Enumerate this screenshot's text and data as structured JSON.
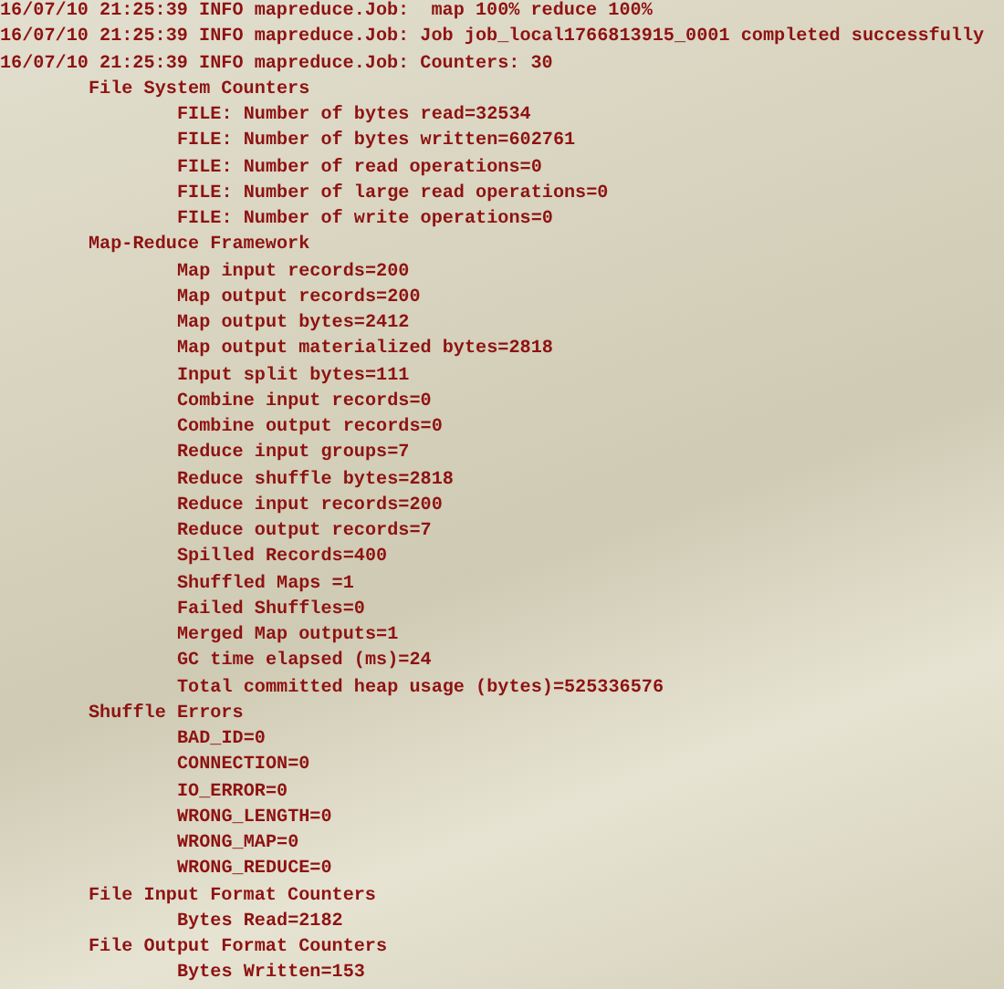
{
  "log_lines": [
    "16/07/10 21:25:39 INFO mapreduce.Job:  map 100% reduce 100%",
    "16/07/10 21:25:39 INFO mapreduce.Job: Job job_local1766813915_0001 completed successfully",
    "16/07/10 21:25:39 INFO mapreduce.Job: Counters: 30"
  ],
  "counter_groups": [
    {
      "title": "File System Counters",
      "counters": [
        "FILE: Number of bytes read=32534",
        "FILE: Number of bytes written=602761",
        "FILE: Number of read operations=0",
        "FILE: Number of large read operations=0",
        "FILE: Number of write operations=0"
      ]
    },
    {
      "title": "Map-Reduce Framework",
      "counters": [
        "Map input records=200",
        "Map output records=200",
        "Map output bytes=2412",
        "Map output materialized bytes=2818",
        "Input split bytes=111",
        "Combine input records=0",
        "Combine output records=0",
        "Reduce input groups=7",
        "Reduce shuffle bytes=2818",
        "Reduce input records=200",
        "Reduce output records=7",
        "Spilled Records=400",
        "Shuffled Maps =1",
        "Failed Shuffles=0",
        "Merged Map outputs=1",
        "GC time elapsed (ms)=24",
        "Total committed heap usage (bytes)=525336576"
      ]
    },
    {
      "title": "Shuffle Errors",
      "counters": [
        "BAD_ID=0",
        "CONNECTION=0",
        "IO_ERROR=0",
        "WRONG_LENGTH=0",
        "WRONG_MAP=0",
        "WRONG_REDUCE=0"
      ]
    },
    {
      "title": "File Input Format Counters",
      "counters": [
        "Bytes Read=2182"
      ]
    },
    {
      "title": "File Output Format Counters",
      "counters": [
        "Bytes Written=153"
      ]
    }
  ]
}
